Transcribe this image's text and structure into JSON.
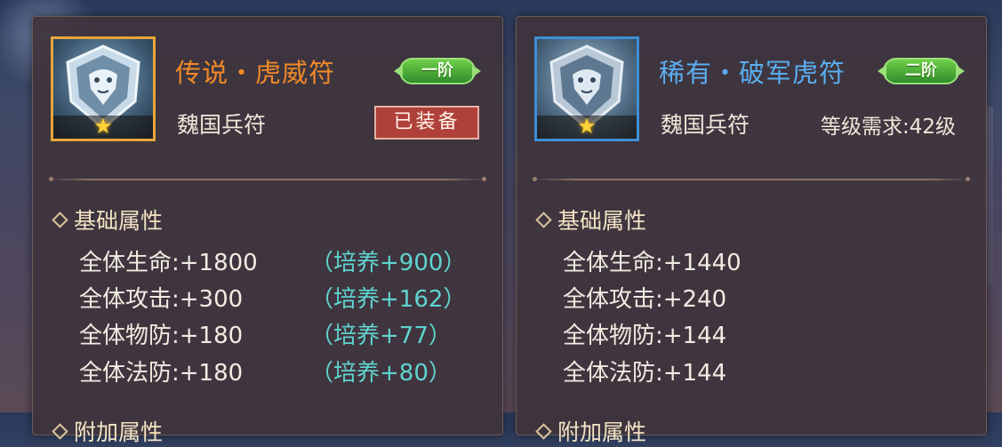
{
  "left_card": {
    "name": "传说・虎威符",
    "rank": "一阶",
    "faction": "魏国兵符",
    "equipped_label": "已装备",
    "section_base": "基础属性",
    "stats": [
      {
        "label": "全体生命:+1800",
        "cultivate": "（培养+900）"
      },
      {
        "label": "全体攻击:+300",
        "cultivate": "（培养+162）"
      },
      {
        "label": "全体物防:+180",
        "cultivate": "（培养+77）"
      },
      {
        "label": "全体法防:+180",
        "cultivate": "（培养+80）"
      }
    ],
    "section_extra": "附加属性"
  },
  "right_card": {
    "name": "稀有・破军虎符",
    "rank": "二阶",
    "faction": "魏国兵符",
    "level_requirement": "等级需求:42级",
    "section_base": "基础属性",
    "stats": [
      {
        "label": "全体生命:+1440"
      },
      {
        "label": "全体攻击:+240"
      },
      {
        "label": "全体物防:+144"
      },
      {
        "label": "全体法防:+144"
      }
    ],
    "section_extra": "附加属性"
  },
  "colors": {
    "legend_name": "#f08a28",
    "rare_name": "#5aaef0",
    "cultivate_text": "#5fd4d0",
    "equipped_bg": "#b0413a",
    "rank_badge": "#4fb03a"
  },
  "icons": [
    "tiger-emblem-icon",
    "star-icon",
    "diamond-bullet-icon"
  ]
}
